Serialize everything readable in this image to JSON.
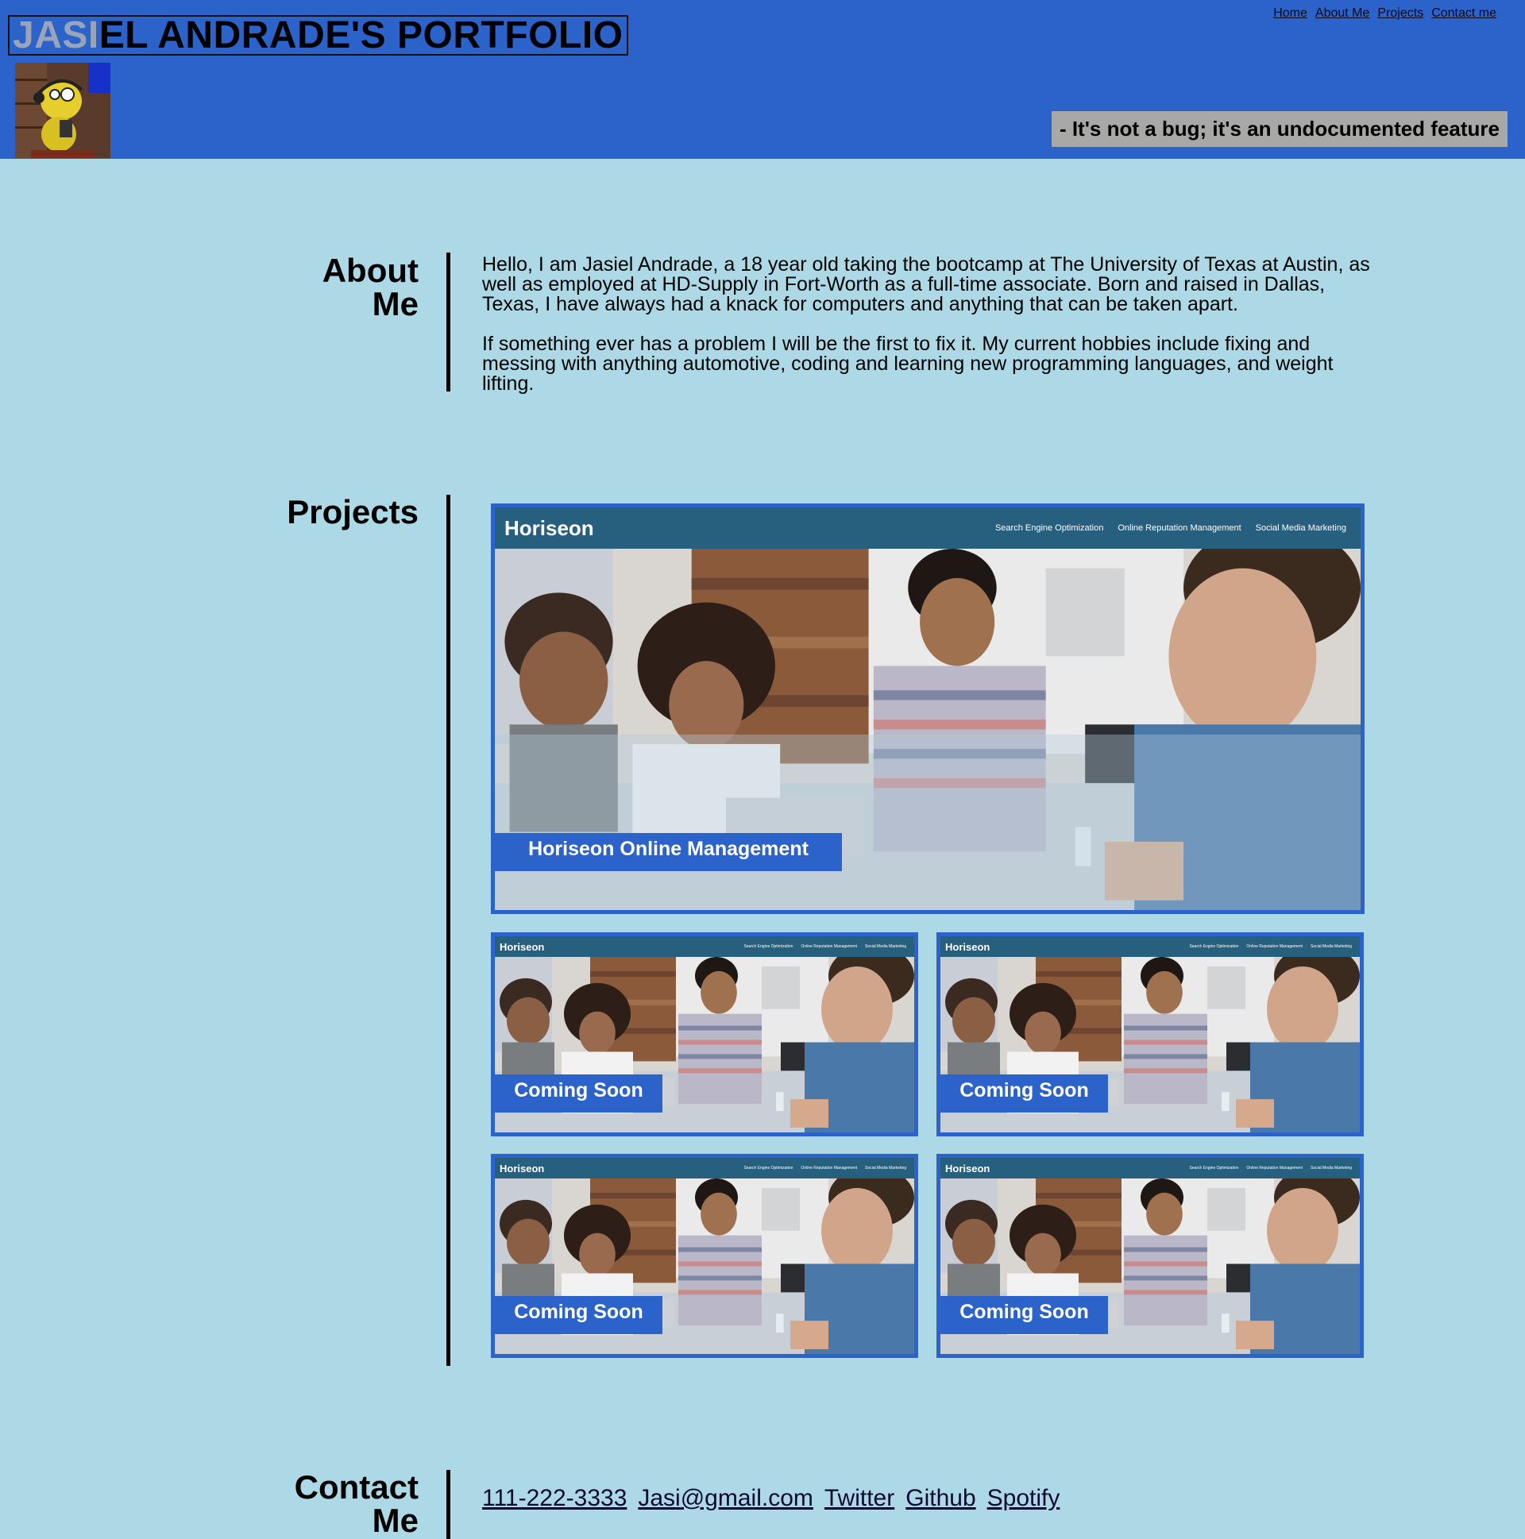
{
  "header": {
    "title_highlight": "JASI",
    "title_rest": "EL ANDRADE'S PORTFOLIO",
    "quote": "- It's not a bug; it's an undocumented feature",
    "bg_color": "#2b63cb"
  },
  "nav": {
    "home": "Home",
    "about": "About Me",
    "projects": "Projects",
    "contact": "Contact me"
  },
  "about": {
    "title_line1": "About",
    "title_line2": "Me",
    "p1": "Hello, I am Jasiel Andrade, a 18 year old taking the bootcamp at The University of Texas at Austin, as well as employed at HD-Supply in Fort-Worth as a full-time associate. Born and raised in Dallas, Texas, I have always had a knack for computers and anything that can be taken apart.",
    "p2": "If something ever has a problem I will be the first to fix it. My current hobbies include fixing and messing with anything automotive, coding and learning new programming languages, and weight lifting."
  },
  "projects": {
    "title": "Projects",
    "preview": {
      "brand": "Horiseon",
      "link1": "Search Engine Optimization",
      "link2": "Online Reputation Management",
      "link3": "Social Media Marketing"
    },
    "main_label": "Horiseon Online Management",
    "coming_soon": "Coming Soon"
  },
  "contact": {
    "title_line1": "Contact",
    "title_line2": "Me",
    "phone": "111-222-3333",
    "email": "Jasi@gmail.com",
    "twitter": "Twitter",
    "github": "Github",
    "spotify": "Spotify"
  },
  "colors": {
    "page_bg": "#add8e6",
    "accent": "#2b63cb",
    "quote_bg": "#a8a8a8"
  }
}
